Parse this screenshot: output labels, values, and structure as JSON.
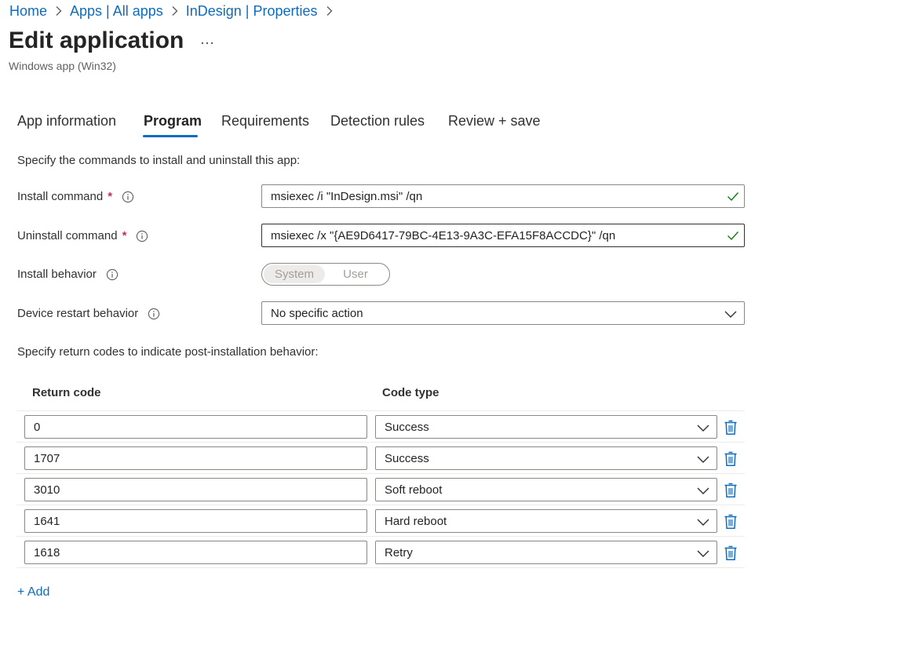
{
  "breadcrumb": [
    {
      "label": "Home"
    },
    {
      "label": "Apps | All apps"
    },
    {
      "label": "InDesign | Properties"
    }
  ],
  "header": {
    "title": "Edit application",
    "more_label": "...",
    "subtitle": "Windows app (Win32)"
  },
  "tabs": [
    {
      "label": "App information",
      "active": false
    },
    {
      "label": "Program",
      "active": true
    },
    {
      "label": "Requirements",
      "active": false
    },
    {
      "label": "Detection rules",
      "active": false
    },
    {
      "label": "Review + save",
      "active": false
    }
  ],
  "program": {
    "intro": "Specify the commands to install and uninstall this app:",
    "install_command": {
      "label": "Install command",
      "required_mark": "*",
      "value": "msiexec /i \"InDesign.msi\" /qn",
      "valid": true
    },
    "uninstall_command": {
      "label": "Uninstall command",
      "required_mark": "*",
      "value": "msiexec /x \"{AE9D6417-79BC-4E13-9A3C-EFA15F8ACCDC}\" /qn",
      "valid": true
    },
    "install_behavior": {
      "label": "Install behavior",
      "options": [
        "System",
        "User"
      ],
      "selected": "System"
    },
    "device_restart": {
      "label": "Device restart behavior",
      "value": "No specific action"
    },
    "return_codes_intro": "Specify return codes to indicate post-installation behavior:"
  },
  "return_codes": {
    "headers": {
      "code": "Return code",
      "type": "Code type"
    },
    "rows": [
      {
        "code": "0",
        "type": "Success"
      },
      {
        "code": "1707",
        "type": "Success"
      },
      {
        "code": "3010",
        "type": "Soft reboot"
      },
      {
        "code": "1641",
        "type": "Hard reboot"
      },
      {
        "code": "1618",
        "type": "Retry"
      }
    ],
    "add_label": "+ Add"
  },
  "colors": {
    "accent": "#0f6cbd",
    "required": "#c4314b",
    "valid_check": "#107c10",
    "delete_icon": "#0f6cbd"
  },
  "icons": {
    "breadcrumb_separator": "chevron-right-icon",
    "more": "more-horizontal-icon",
    "info": "info-icon",
    "valid": "checkmark-icon",
    "dropdown": "chevron-down-icon",
    "delete": "trash-icon"
  }
}
